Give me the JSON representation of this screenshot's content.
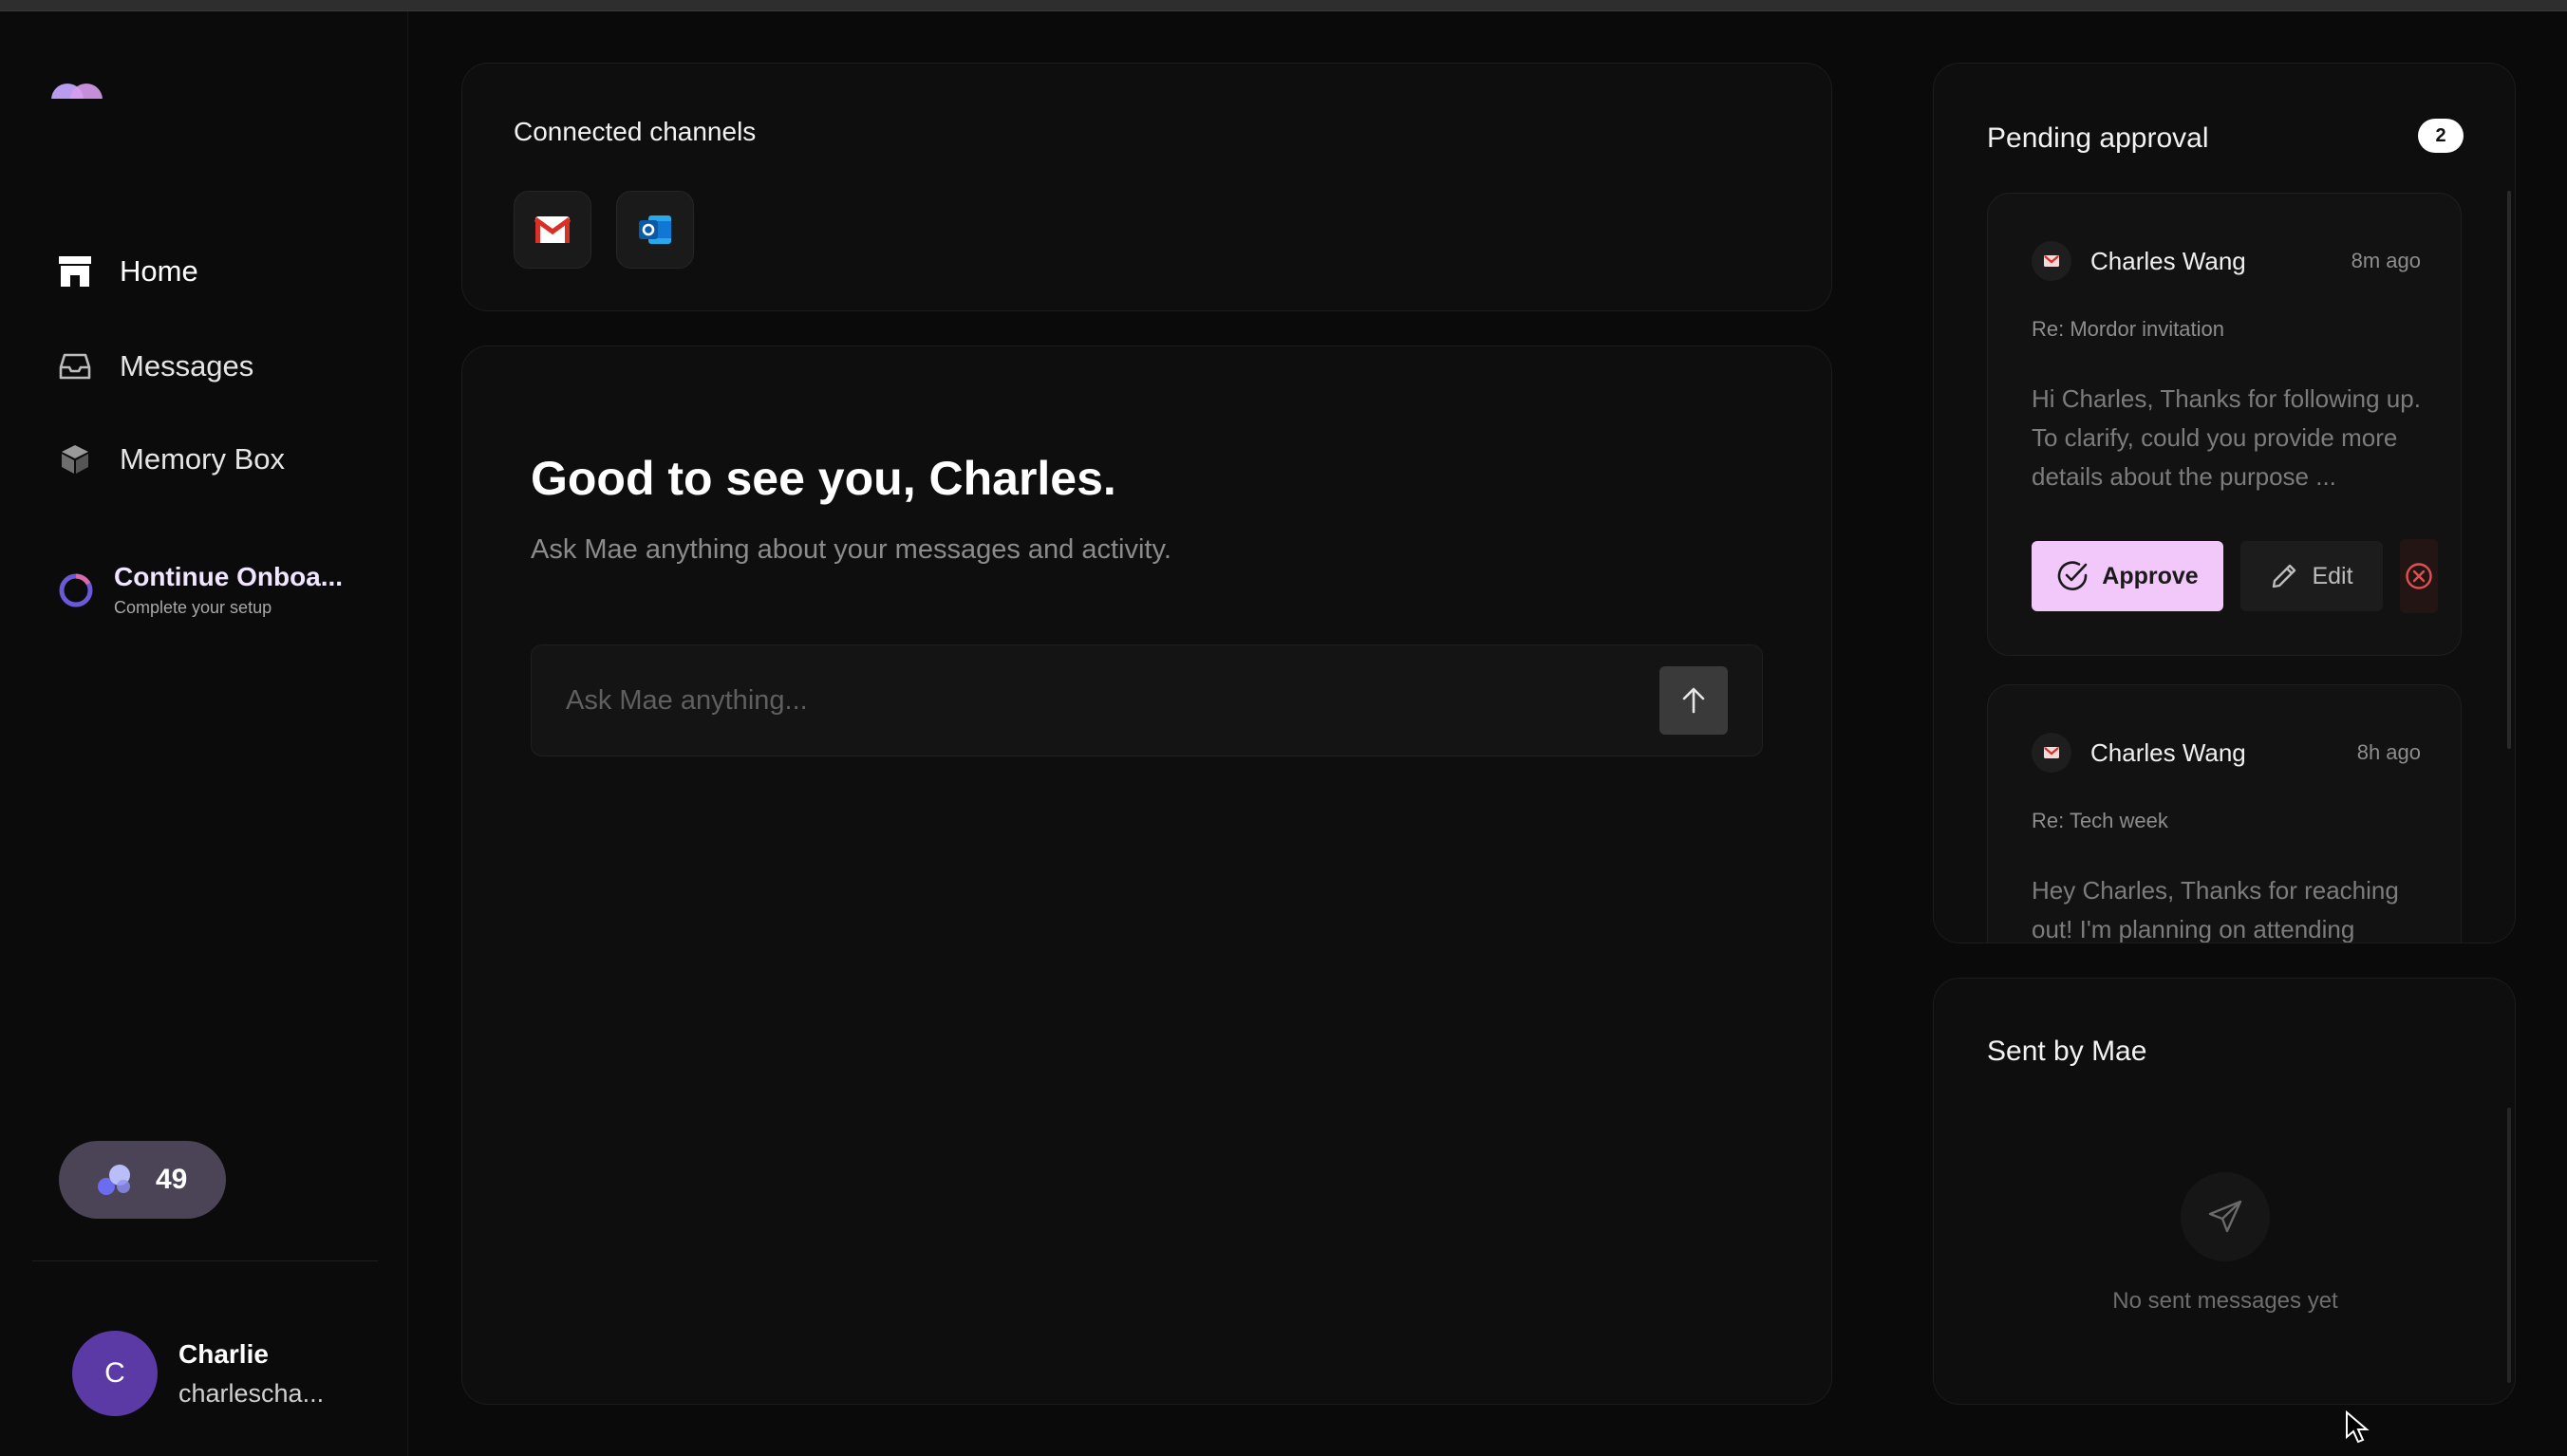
{
  "sidebar": {
    "nav": [
      {
        "label": "Home",
        "icon": "home-icon"
      },
      {
        "label": "Messages",
        "icon": "inbox-icon"
      },
      {
        "label": "Memory Box",
        "icon": "cube-icon"
      }
    ],
    "onboarding": {
      "title": "Continue Onboa...",
      "subtitle": "Complete your setup"
    },
    "credits": {
      "value": "49"
    },
    "user": {
      "initial": "C",
      "name": "Charlie",
      "email": "charlescha..."
    }
  },
  "channels": {
    "title": "Connected channels",
    "items": [
      {
        "name": "gmail",
        "icon": "gmail-icon"
      },
      {
        "name": "outlook",
        "icon": "outlook-icon"
      }
    ]
  },
  "chat": {
    "greeting": "Good to see you, Charles.",
    "subtitle": "Ask Mae anything about your messages and activity.",
    "placeholder": "Ask Mae anything..."
  },
  "pending": {
    "title": "Pending approval",
    "count": "2",
    "messages": [
      {
        "sender": "Charles Wang",
        "time": "8m ago",
        "subject": "Re: Mordor invitation",
        "preview": "Hi Charles, Thanks for following up. To clarify, could you provide more details about the purpose ...",
        "approve_label": "Approve",
        "edit_label": "Edit"
      },
      {
        "sender": "Charles Wang",
        "time": "8h ago",
        "subject": "Re: Tech week",
        "preview": "Hey Charles, Thanks for reaching out! I'm planning on attending"
      }
    ]
  },
  "sent": {
    "title": "Sent by Mae",
    "empty": "No sent messages yet"
  },
  "colors": {
    "background": "#0a0a0a",
    "card": "#0e0e0e",
    "approve": "#f2c8fb",
    "avatar": "#5b3aa6",
    "credits_pill": "#4a4456",
    "reject": "#e05050"
  }
}
